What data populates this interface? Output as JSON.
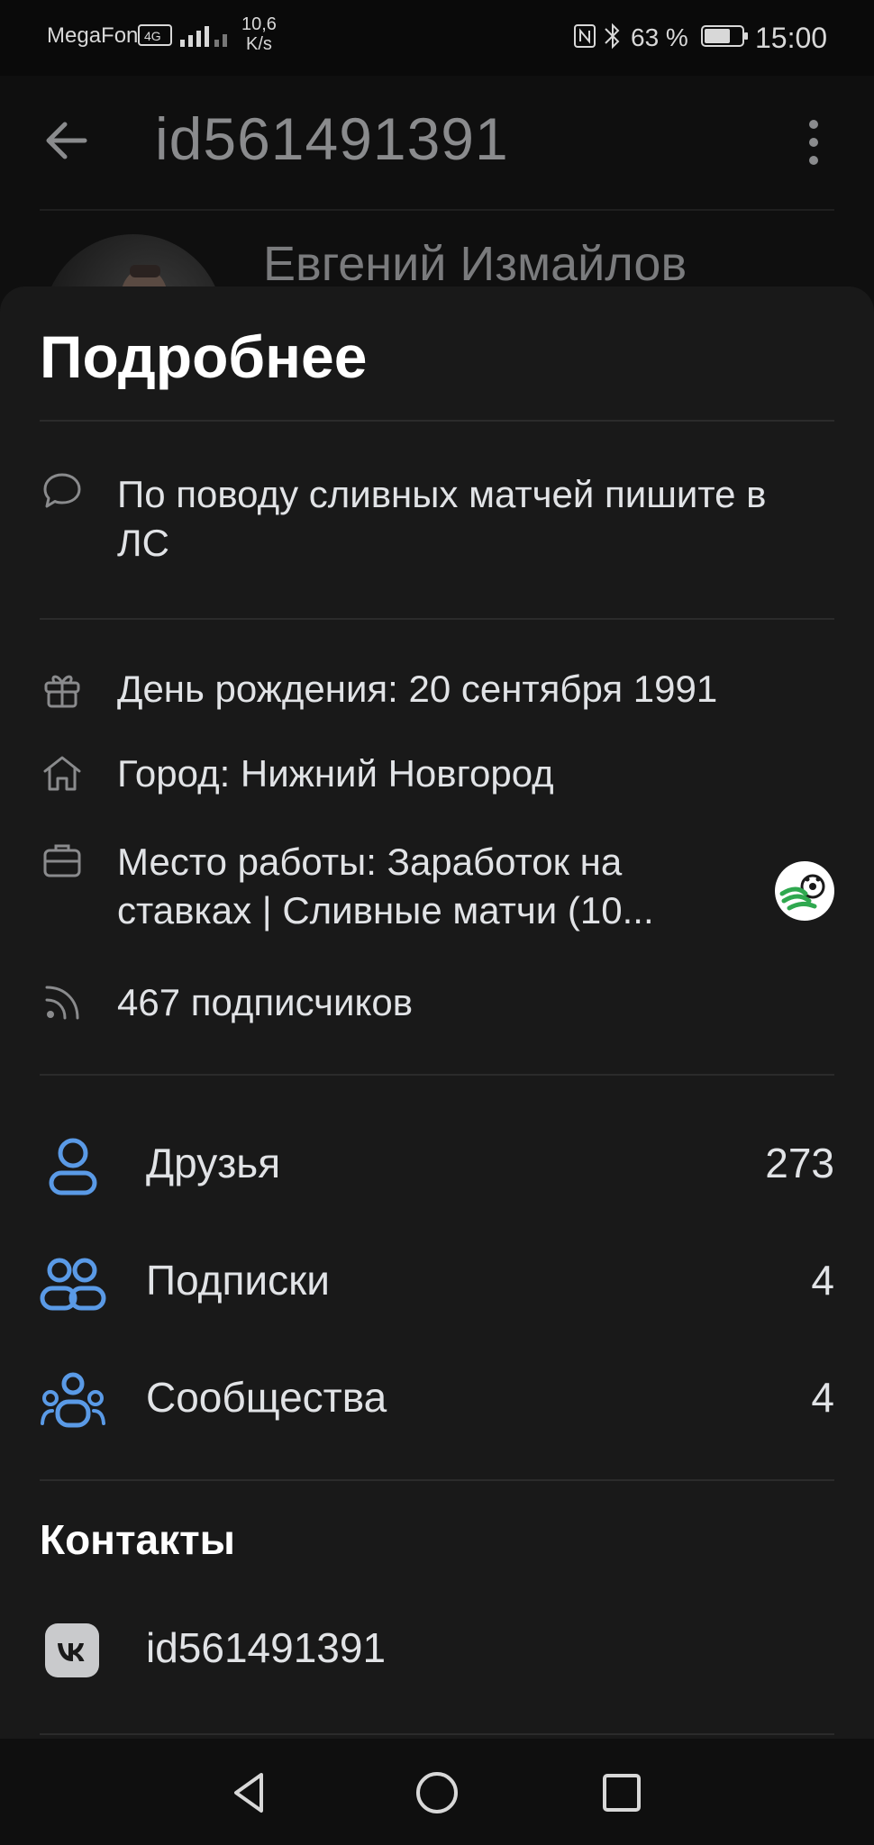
{
  "status_bar": {
    "carrier": "MegaFon",
    "speed_value": "10,6",
    "speed_unit": "K/s",
    "battery_percent": "63 %",
    "time": "15:00",
    "icons": [
      "signal-icon",
      "wifi-icon",
      "nfc-icon",
      "bluetooth-icon",
      "battery-icon"
    ]
  },
  "profile": {
    "header_title": "id561491391",
    "name": "Евгений Измайлов"
  },
  "sheet": {
    "title": "Подробнее",
    "status": "По поводу сливных матчей пишите в ЛС",
    "info": [
      {
        "icon": "gift-icon",
        "text": "День рождения: 20 сентября 1991"
      },
      {
        "icon": "home-icon",
        "text": "Город: Нижний Новгород"
      },
      {
        "icon": "briefcase-icon",
        "text": "Место работы: Заработок на ставках | Сливные матчи (10..."
      },
      {
        "icon": "rss-icon",
        "text": "467 подписчиков"
      }
    ],
    "stats": [
      {
        "icon": "user-icon",
        "label": "Друзья",
        "count": "273"
      },
      {
        "icon": "users-icon",
        "label": "Подписки",
        "count": "4"
      },
      {
        "icon": "community-icon",
        "label": "Сообщества",
        "count": "4"
      }
    ],
    "contacts_title": "Контакты",
    "contact_vk": "id561491391"
  },
  "colors": {
    "accent": "#5a9ae6",
    "sheet_bg": "#191919",
    "text": "#e1e3e6"
  }
}
